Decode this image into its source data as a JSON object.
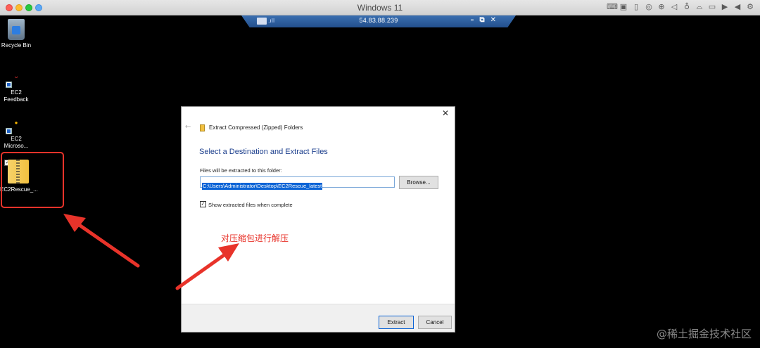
{
  "host": {
    "title": "Windows 11",
    "tray_icons": [
      "keyboard-icon",
      "cpu-icon",
      "usb-icon",
      "shared-icon",
      "network-icon",
      "speaker-icon",
      "microphone-icon",
      "printer-icon",
      "camera-icon",
      "screen-record-icon",
      "play-icon",
      "settings-icon"
    ]
  },
  "rdp": {
    "host_address": "54.83.88.239",
    "signal": ".ıll",
    "minimize": "–",
    "restore": "⧉",
    "close": "✕"
  },
  "desktop": {
    "icons": [
      {
        "label": "Recycle Bin"
      },
      {
        "label": "EC2 Feedback",
        "label_line1": "EC2",
        "label_line2": "Feedback"
      },
      {
        "label": "EC2 Microso...",
        "label_line1": "EC2",
        "label_line2": "Microso..."
      },
      {
        "label": "EC2Rescue_..."
      }
    ],
    "tiny_marks": [
      "ᴗ",
      "●"
    ]
  },
  "dialog": {
    "close": "✕",
    "back": "←",
    "app_title": "Extract Compressed (Zipped) Folders",
    "heading": "Select a Destination and Extract Files",
    "folder_label": "Files will be extracted to this folder:",
    "path_value": "C:\\Users\\Administrator\\Desktop\\EC2Rescue_latest",
    "browse_label": "Browse...",
    "checkbox_mark": "✓",
    "show_files_label": "Show extracted files when complete",
    "show_files_checked": true,
    "extract_label": "Extract",
    "cancel_label": "Cancel"
  },
  "annotation": {
    "text": "对压缩包进行解压",
    "color": "#e8332a"
  },
  "watermark": "@稀土掘金技术社区"
}
